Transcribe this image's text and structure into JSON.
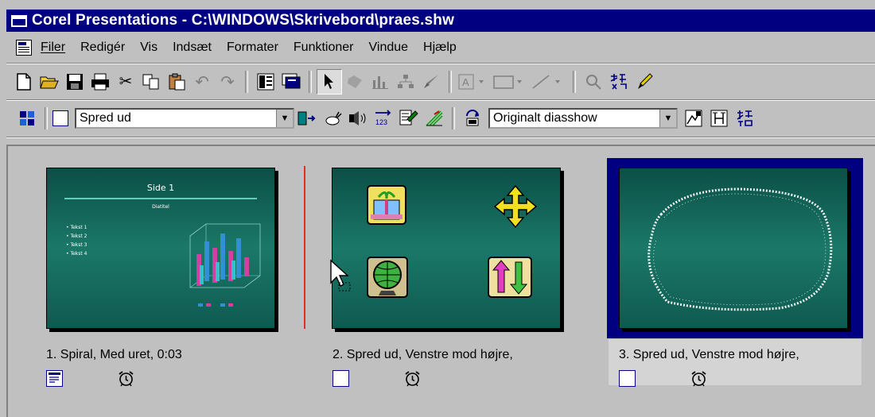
{
  "window": {
    "title": "Corel Presentations - C:\\WINDOWS\\Skrivebord\\praes.shw"
  },
  "menu": {
    "items": [
      "Filer",
      "Redigér",
      "Vis",
      "Indsæt",
      "Formater",
      "Funktioner",
      "Vindue",
      "Hjælp"
    ]
  },
  "toolbar1": {
    "buttons": [
      {
        "name": "new-icon",
        "glyph": "🗋"
      },
      {
        "name": "open-icon",
        "glyph": "📂"
      },
      {
        "name": "save-icon",
        "glyph": "💾"
      },
      {
        "name": "print-icon",
        "glyph": "🖨"
      },
      {
        "name": "cut-icon",
        "glyph": "✂"
      },
      {
        "name": "copy-icon",
        "glyph": "⧉"
      },
      {
        "name": "paste-icon",
        "glyph": "📋"
      },
      {
        "name": "undo-icon",
        "glyph": "↶"
      },
      {
        "name": "redo-icon",
        "glyph": "↷"
      }
    ]
  },
  "toolbar2": {
    "transition_combo": "Spred ud",
    "show_combo": "Originalt diasshow"
  },
  "slides": [
    {
      "caption": "1. Spiral, Med uret,  0:03",
      "title": "Side 1",
      "subtitle": "Diatitel",
      "bullets": [
        "• Tekst 1",
        "• Tekst 2",
        "• Tekst 3",
        "• Tekst 4"
      ],
      "icon1": "slide-properties-icon",
      "icon2": "timer-alarm-icon"
    },
    {
      "caption": "2. Spred ud, Venstre mod højre,",
      "icon1": "white-square-icon",
      "icon2": "timer-alarm-icon"
    },
    {
      "caption": "3. Spred ud, Venstre mod højre,",
      "icon1": "white-square-icon",
      "icon2": "timer-alarm-icon",
      "selected": true
    }
  ],
  "colors": {
    "titlebar": "#000080",
    "selection": "#000080",
    "slide_bg": "#1b7868",
    "insert_marker": "#e03020"
  }
}
